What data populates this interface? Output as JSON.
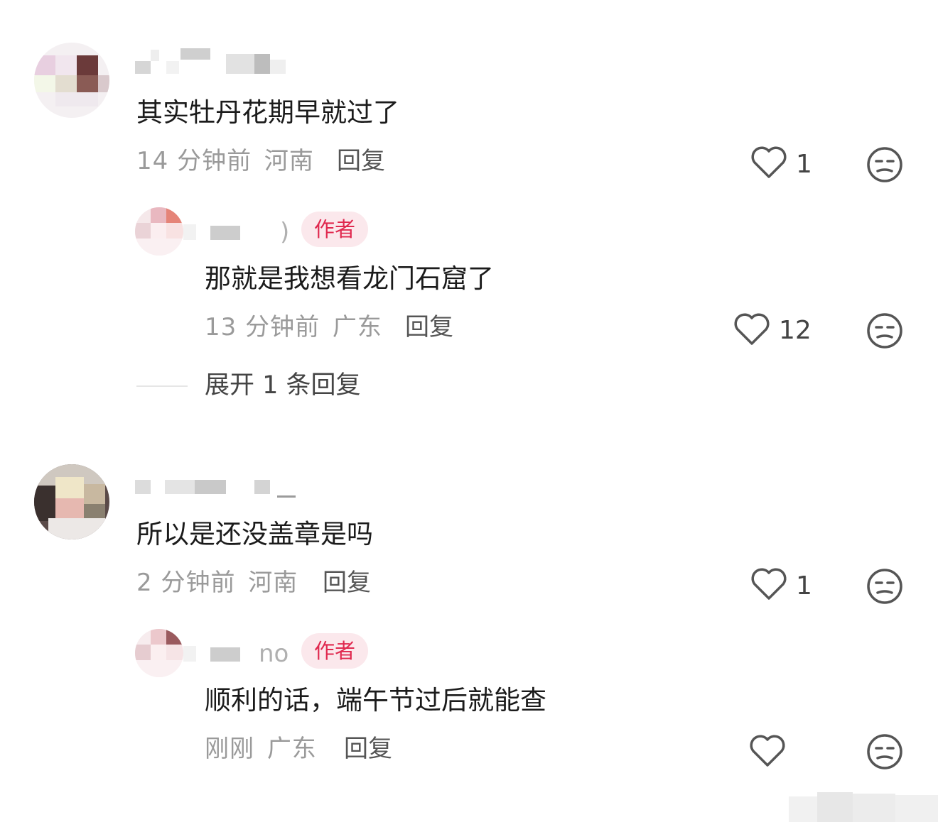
{
  "comments": [
    {
      "text": "其实牡丹花期早就过了",
      "time": "14 分钟前",
      "location": "河南",
      "reply_label": "回复",
      "likes": "1",
      "replies": [
        {
          "name_tail": ")",
          "badge": "作者",
          "text": "那就是我想看龙门石窟了",
          "time": "13 分钟前",
          "location": "广东",
          "reply_label": "回复",
          "likes": "12"
        }
      ],
      "expand_label": "展开 1 条回复"
    },
    {
      "text": "所以是还没盖章是吗",
      "time": "2 分钟前",
      "location": "河南",
      "reply_label": "回复",
      "likes": "1",
      "replies": [
        {
          "name_tail": "no",
          "badge": "作者",
          "text": "顺利的话，端午节过后就能查",
          "time": "刚刚",
          "location": "广东",
          "reply_label": "回复",
          "likes": ""
        }
      ]
    }
  ],
  "icons": {
    "like": "heart-outline-icon",
    "dislike": "unamused-face-icon"
  },
  "colors": {
    "badge_bg": "#fbe8ec",
    "badge_text": "#e0294f",
    "meta_text": "#9a9a9a"
  }
}
